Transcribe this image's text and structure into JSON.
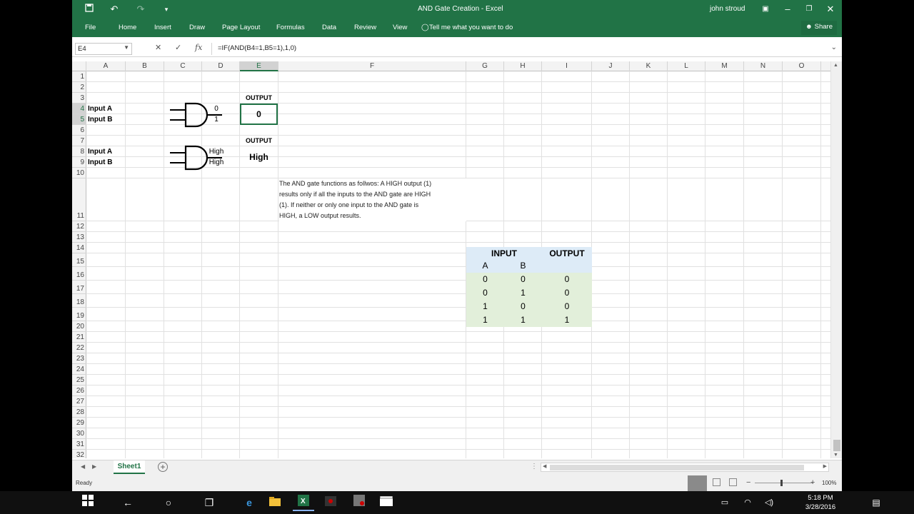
{
  "title": {
    "window_title": "AND Gate Creation  -  Excel",
    "user": "john stroud"
  },
  "ribbon": {
    "tabs": [
      "File",
      "Home",
      "Insert",
      "Draw",
      "Page Layout",
      "Formulas",
      "Data",
      "Review",
      "View"
    ],
    "tell_me": "Tell me what you want to do",
    "share": "Share"
  },
  "formula_bar": {
    "name_box": "E4",
    "formula": "=IF(AND(B4=1,B5=1),1,0)"
  },
  "sheet": {
    "columns": [
      "A",
      "B",
      "C",
      "D",
      "E",
      "F",
      "G",
      "H",
      "I",
      "J",
      "K",
      "L",
      "M",
      "N",
      "O"
    ],
    "rows": [
      "1",
      "2",
      "3",
      "4",
      "5",
      "6",
      "7",
      "8",
      "9",
      "10",
      "11",
      "12",
      "13",
      "14",
      "15",
      "16",
      "17",
      "18",
      "19",
      "20",
      "21",
      "22",
      "23",
      "24",
      "25",
      "26",
      "27",
      "28",
      "29",
      "30",
      "31",
      "32"
    ],
    "a4": "Input A",
    "a5": "Input B",
    "b4": "0",
    "b5": "1",
    "e3": "OUTPUT",
    "e4": "0",
    "a8": "Input A",
    "a9": "Input B",
    "b8": "High",
    "b9": "High",
    "e7": "OUTPUT",
    "e8": "High",
    "description_lines": [
      "The AND gate functions as follwos: A HIGH output (1)",
      "results only if all the inputs to the AND gate are HIGH",
      "(1). If neither or only one input to the AND gate is",
      "HIGH, a LOW output results."
    ]
  },
  "truth_table": {
    "input_header": "INPUT",
    "output_header": "OUTPUT",
    "col_a": "A",
    "col_b": "B",
    "rows": [
      [
        "0",
        "0",
        "0"
      ],
      [
        "0",
        "1",
        "0"
      ],
      [
        "1",
        "0",
        "0"
      ],
      [
        "1",
        "1",
        "1"
      ]
    ],
    "header_color": "#ddebf7",
    "body_color": "#e2efda"
  },
  "sheet_tab": "Sheet1",
  "status": {
    "ready": "Ready",
    "zoom": "100%"
  },
  "taskbar": {
    "time": "5:18 PM",
    "date": "3/28/2016"
  },
  "colors": {
    "excel_green": "#217346"
  }
}
